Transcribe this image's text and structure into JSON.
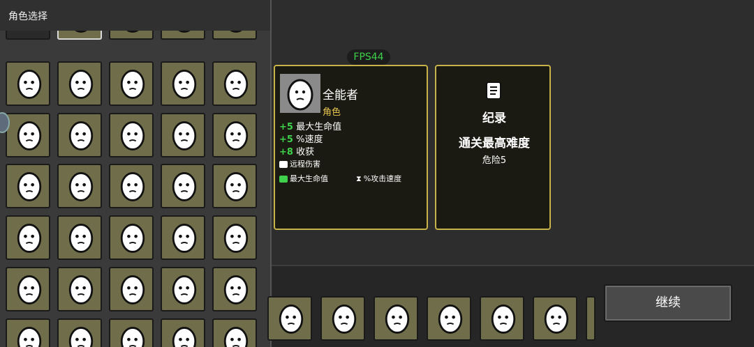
{
  "left_panel": {
    "title": "角色选择"
  },
  "fps": "FPS44",
  "character": {
    "name": "全能者",
    "type": "角色",
    "stats": [
      {
        "num": "+5",
        "label": "最大生命值"
      },
      {
        "num": "+5",
        "label": "%速度"
      },
      {
        "num": "+8",
        "label": "收获"
      }
    ],
    "tag_ranged": "远程伤害",
    "tag_maxhp": "最大生命值",
    "tag_atkspeed": "%攻击速度"
  },
  "record": {
    "title": "纪录",
    "subtitle": "通关最高难度",
    "value": "危险5"
  },
  "continue_label": "继续",
  "colors": {
    "accent_gold": "#c8b24a",
    "cell_bg": "#6f6d4a",
    "green": "#3fd14c",
    "type_yellow": "#e6c650"
  },
  "icons": {
    "locked": "question-mark-icon",
    "record": "scroll-icon"
  }
}
